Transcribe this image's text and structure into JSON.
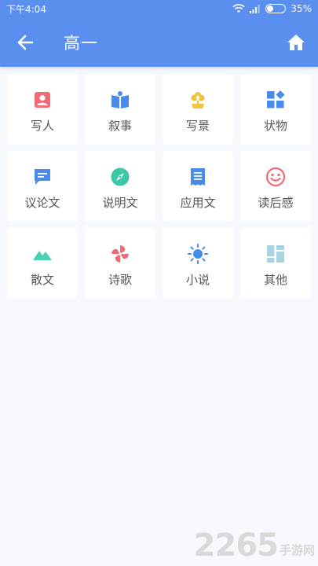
{
  "status_bar": {
    "time": "下午4:04",
    "battery": "35%",
    "battery_level": 0.35
  },
  "header": {
    "title": "高一",
    "back_icon": "arrow-left-icon",
    "home_icon": "home-icon",
    "color": "#5a8ff0"
  },
  "categories": [
    {
      "label": "写人",
      "icon": "person-badge-icon",
      "color": "#f06b73"
    },
    {
      "label": "叙事",
      "icon": "open-book-icon",
      "color": "#4a8be8"
    },
    {
      "label": "写景",
      "icon": "flower-icon",
      "color": "#f3c33b"
    },
    {
      "label": "状物",
      "icon": "shapes-icon",
      "color": "#4a8be8"
    },
    {
      "label": "议论文",
      "icon": "chat-bubble-icon",
      "color": "#4a8be8"
    },
    {
      "label": "说明文",
      "icon": "compass-icon",
      "color": "#3cc7a8"
    },
    {
      "label": "应用文",
      "icon": "document-icon",
      "color": "#4a8be8"
    },
    {
      "label": "读后感",
      "icon": "smiley-icon",
      "color": "#f06b73"
    },
    {
      "label": "散文",
      "icon": "mountain-icon",
      "color": "#49d1b4"
    },
    {
      "label": "诗歌",
      "icon": "pinwheel-icon",
      "color": "#f06b73"
    },
    {
      "label": "小说",
      "icon": "sun-icon",
      "color": "#4a8be8"
    },
    {
      "label": "其他",
      "icon": "dashboard-icon",
      "color": "#a8d4e6"
    }
  ],
  "watermark": {
    "number": "2265",
    "text": "手游网"
  }
}
